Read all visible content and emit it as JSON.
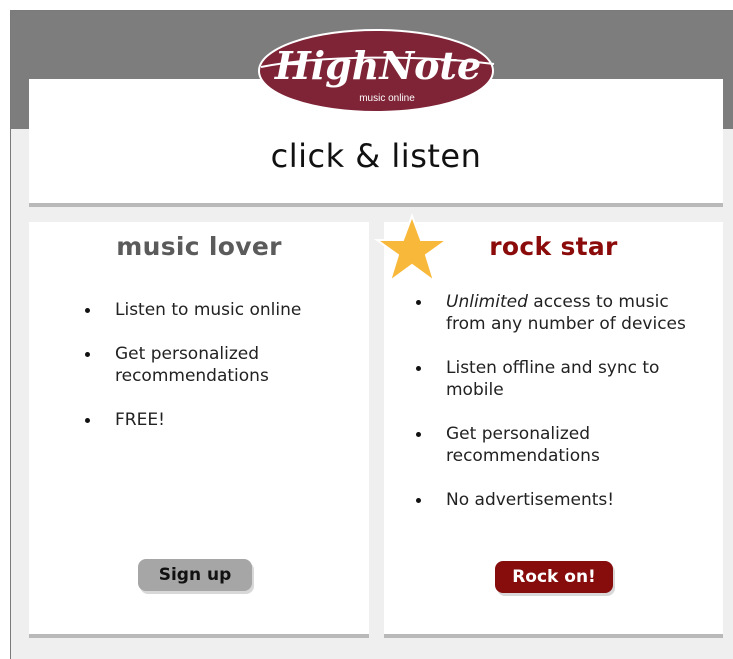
{
  "logo": {
    "name": "HighNote",
    "subtitle": "music online"
  },
  "hero": {
    "tagline": "click & listen"
  },
  "plans": {
    "music_lover": {
      "title": "music lover",
      "features": [
        "Listen to music online",
        "Get personalized recommendations",
        "FREE!"
      ],
      "button_label": "Sign up"
    },
    "rock_star": {
      "title": "rock star",
      "features": [
        {
          "emphasis": "Unlimited",
          "text": " access to music from any number of devices"
        },
        {
          "emphasis": "",
          "text": "Listen offline and sync to mobile"
        },
        {
          "emphasis": "",
          "text": "Get personalized recommendations"
        },
        {
          "emphasis": "",
          "text": "No advertisements!"
        }
      ],
      "button_label": "Rock on!"
    }
  },
  "colors": {
    "brand_maroon": "#7e2436",
    "rock_red": "#870d0d",
    "star_gold": "#f8b93a",
    "band_gray": "#7d7d7d",
    "page_gray": "#efefef"
  },
  "icons": {
    "star": "star-icon",
    "bullet": "bullet-icon"
  }
}
